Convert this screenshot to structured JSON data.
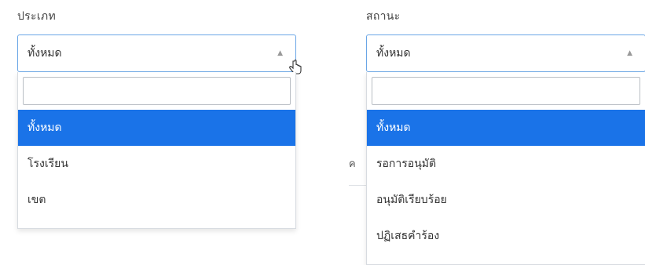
{
  "filter_type": {
    "label": "ประเภท",
    "selected": "ทั้งหมด",
    "search_value": "",
    "options": [
      "ทั้งหมด",
      "โรงเรียน",
      "เขต"
    ],
    "highlighted_index": 0
  },
  "filter_status": {
    "label": "สถานะ",
    "selected": "ทั้งหมด",
    "search_value": "",
    "options": [
      "ทั้งหมด",
      "รอการอนุมัติ",
      "อนุมัติเรียบร้อย",
      "ปฏิเสธคำร้อง"
    ],
    "highlighted_index": 0
  },
  "behind_text": "ค",
  "colors": {
    "highlight": "#1a73e8",
    "border": "#c8ccd0"
  }
}
